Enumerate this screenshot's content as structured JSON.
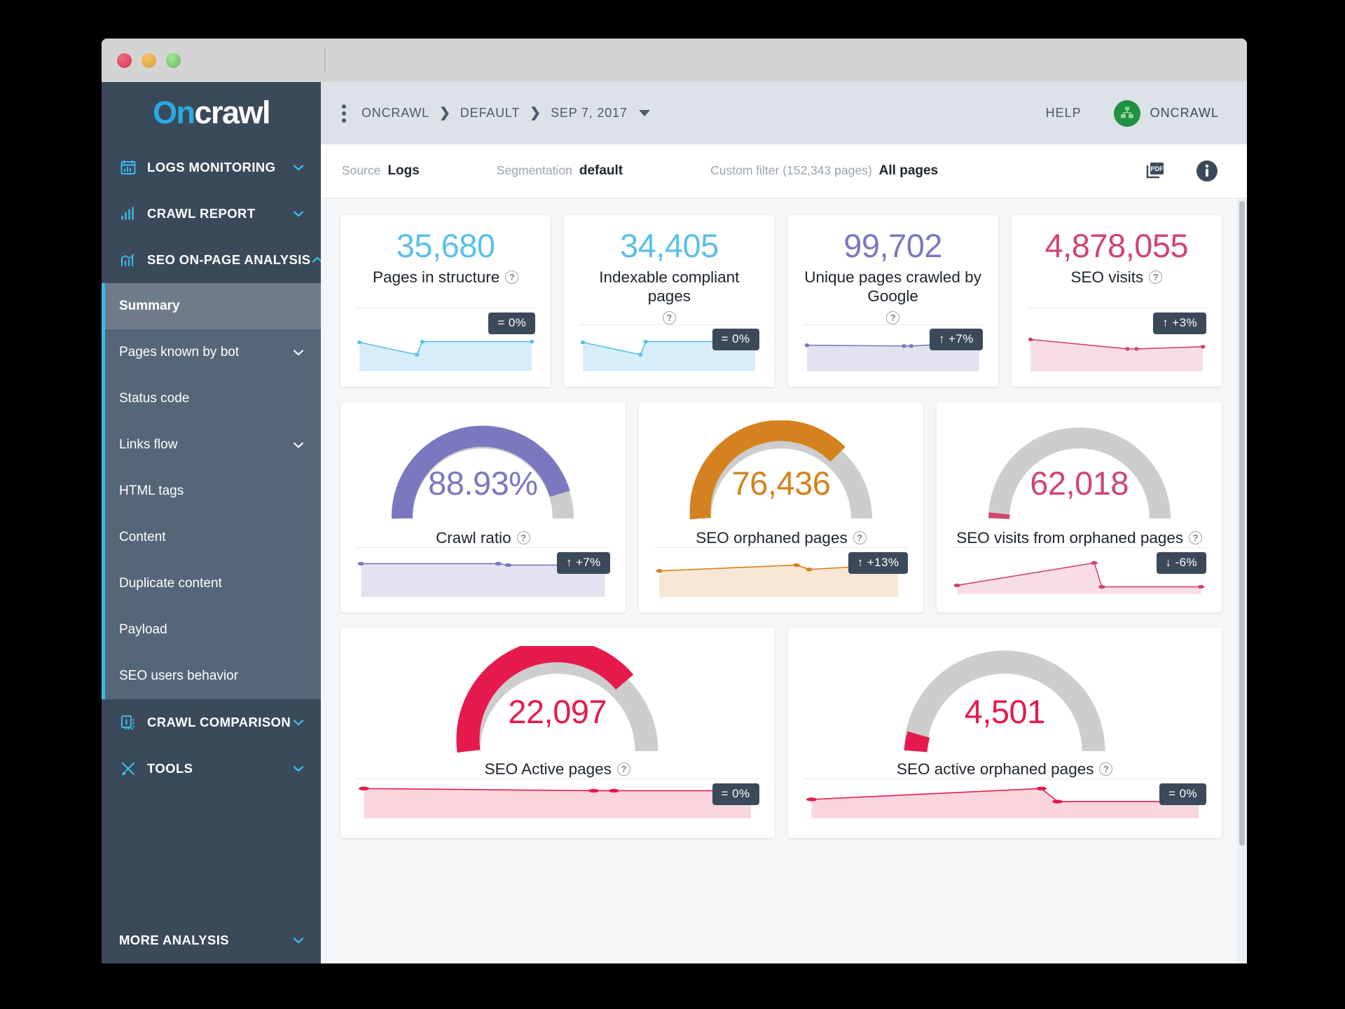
{
  "window": {
    "traffic_lights": [
      "close",
      "minimize",
      "maximize"
    ]
  },
  "sidebar": {
    "logo_on": "On",
    "logo_crawl": "crawl",
    "groups": [
      {
        "label": "LOGS MONITORING",
        "icon": "calendar-chart-icon",
        "expanded": false
      },
      {
        "label": "CRAWL REPORT",
        "icon": "bar-chart-icon",
        "expanded": false
      },
      {
        "label": "SEO ON-PAGE ANALYSIS",
        "icon": "line-chart-icon",
        "expanded": true
      }
    ],
    "submenu": [
      {
        "label": "Summary",
        "selected": true,
        "chevron": false
      },
      {
        "label": "Pages known by bot",
        "selected": false,
        "chevron": true
      },
      {
        "label": "Status code",
        "selected": false,
        "chevron": false
      },
      {
        "label": "Links flow",
        "selected": false,
        "chevron": true
      },
      {
        "label": "HTML tags",
        "selected": false,
        "chevron": false
      },
      {
        "label": "Content",
        "selected": false,
        "chevron": false
      },
      {
        "label": "Duplicate content",
        "selected": false,
        "chevron": false
      },
      {
        "label": "Payload",
        "selected": false,
        "chevron": false
      },
      {
        "label": "SEO users behavior",
        "selected": false,
        "chevron": false
      }
    ],
    "groups_bottom": [
      {
        "label": "CRAWL COMPARISON",
        "icon": "copy-pages-icon"
      },
      {
        "label": "TOOLS",
        "icon": "tools-icon"
      }
    ],
    "more_analysis": "MORE ANALYSIS"
  },
  "topbar": {
    "breadcrumbs": [
      "ONCRAWL",
      "DEFAULT",
      "SEP 7, 2017"
    ],
    "separator": "›",
    "help": "HELP",
    "user": "ONCRAWL"
  },
  "filterbar": {
    "source_label": "Source",
    "source_value": "Logs",
    "segmentation_label": "Segmentation",
    "segmentation_value": "default",
    "custom_filter_label": "Custom filter (152,343 pages)",
    "custom_filter_value": "All pages",
    "pdf_icon": "pdf-export-icon",
    "info_icon": "info-icon"
  },
  "colors": {
    "cyan": "#5bc0e8",
    "cyan_fill": "#d7eefa",
    "purple": "#7a78bf",
    "purple_fill": "#e3e2f0",
    "pink": "#d1456f",
    "pink_fill": "#f9dde5",
    "orange": "#d4821f",
    "orange_fill": "#f7e7d4",
    "crimson": "#e61a4d",
    "crimson_fill": "#f9d6de",
    "gauge_track": "#cdcdcd",
    "badge_bg": "#3b4a5a"
  },
  "chart_data": [
    {
      "type": "line",
      "title": "Pages in structure",
      "value": "35,680",
      "color_key": "cyan",
      "delta": "= 0%",
      "delta_dir": "flat",
      "x": [
        0,
        1,
        2,
        3
      ],
      "values": [
        62,
        34,
        62,
        62
      ],
      "ylim": [
        0,
        100
      ]
    },
    {
      "type": "line",
      "title": "Indexable compliant pages",
      "value": "34,405",
      "color_key": "cyan",
      "delta": "= 0%",
      "delta_dir": "flat",
      "x": [
        0,
        1,
        2,
        3
      ],
      "values": [
        62,
        34,
        62,
        62
      ],
      "ylim": [
        0,
        100
      ]
    },
    {
      "type": "line",
      "title": "Unique pages crawled by Google",
      "value": "99,702",
      "color_key": "purple",
      "delta": "↑ +7%",
      "delta_dir": "up",
      "x": [
        0,
        1,
        2,
        3
      ],
      "values": [
        70,
        69,
        69,
        75
      ],
      "ylim": [
        0,
        100
      ]
    },
    {
      "type": "line",
      "title": "SEO visits",
      "value": "4,878,055",
      "color_key": "pink",
      "delta": "↑ +3%",
      "delta_dir": "up",
      "x": [
        0,
        1,
        2,
        3
      ],
      "values": [
        78,
        60,
        59,
        62
      ],
      "ylim": [
        0,
        100
      ]
    },
    {
      "type": "gauge",
      "title": "Crawl ratio",
      "value": "88.93%",
      "gauge_pct": 88.93,
      "color_key": "purple",
      "delta": "↑ +7%",
      "delta_dir": "up",
      "x": [
        0,
        1,
        2,
        3
      ],
      "values": [
        88,
        88,
        87,
        88
      ],
      "ylim": [
        0,
        100
      ]
    },
    {
      "type": "gauge",
      "title": "SEO orphaned pages",
      "value": "76,436",
      "gauge_pct": 76,
      "color_key": "orange",
      "delta": "↑ +13%",
      "delta_dir": "up",
      "x": [
        0,
        1,
        2,
        3
      ],
      "values": [
        55,
        72,
        62,
        74
      ],
      "ylim": [
        0,
        100
      ]
    },
    {
      "type": "gauge",
      "title": "SEO visits from orphaned pages",
      "value": "62,018",
      "gauge_pct": 2,
      "color_key": "pink",
      "delta": "↓ -6%",
      "delta_dir": "down",
      "x": [
        0,
        1,
        2,
        3
      ],
      "values": [
        26,
        90,
        20,
        20
      ],
      "ylim": [
        0,
        100
      ]
    },
    {
      "type": "gauge",
      "title": "SEO Active pages",
      "value": "22,097",
      "gauge_pct": 78,
      "color_key": "crimson",
      "delta": "= 0%",
      "delta_dir": "flat",
      "x": [
        0,
        1,
        2,
        3
      ],
      "values": [
        88,
        85,
        85,
        85
      ],
      "ylim": [
        0,
        100
      ]
    },
    {
      "type": "gauge",
      "title": "SEO active orphaned pages",
      "value": "4,501",
      "gauge_pct": 6,
      "color_key": "crimson",
      "delta": "= 0%",
      "delta_dir": "flat",
      "x": [
        0,
        1,
        2,
        3
      ],
      "values": [
        60,
        88,
        45,
        45
      ],
      "ylim": [
        0,
        100
      ]
    }
  ]
}
